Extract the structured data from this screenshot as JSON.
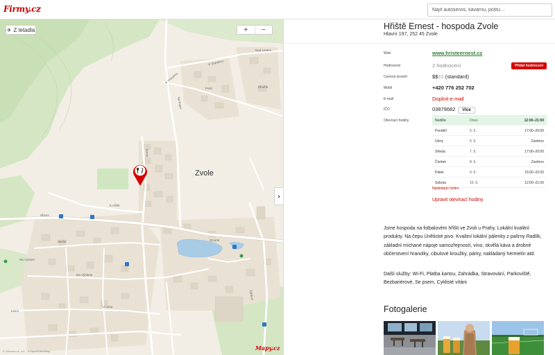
{
  "header": {
    "logo": "Firmy.cz",
    "search_placeholder": "Najít autoservis, kavárnu, poštu…"
  },
  "map": {
    "plane_button": "Z letadla",
    "zoom_in": "+",
    "zoom_out": "−",
    "collapse": "›",
    "labels": {
      "town": "Zvole",
      "nad_lesem": "Nad Lesem",
      "k_vranemu_1": "K Vranému",
      "k_vranemu_2": "K Vranému",
      "strmá": "Strmá",
      "na_kopci": "Na Kopci",
      "polni": "Polní",
      "dlouha": "Dlouhá",
      "k_hristi": "K Hřišti",
      "hlavni": "Hlavní",
      "skolni": "Skolní",
      "na_vyhledu": "Na Výhledu",
      "na_vyslunì": "Na Výsluní",
      "u_lesa": "U Lesa",
      "lesni": "Lesní",
      "dlouha2": "Dlouhá",
      "zabrezi": "Zábřezí"
    },
    "brand": "Mapy.cz",
    "copyright": "© Seznam.cz, a.s. · © OpenStreetMap"
  },
  "business": {
    "name": "Hřiště Ernest - hospoda Zvole",
    "address": "Hlavní 197, 252 45 Zvole",
    "web_label": "Web",
    "web": "www.hristeernest.cz",
    "rating_label": "Hodnocení",
    "rating": "2 hodnocení",
    "add_rating": "Přidat hodnocení",
    "price_label": "Cenová úroveň",
    "price_active": "$$",
    "price_inactive": "$$",
    "price_text": "(standard)",
    "mobile_label": "Mobil",
    "mobile": "+420 776 252 702",
    "email_label": "E-mail",
    "email": "Doplnit e-mail",
    "ico_label": "IČO",
    "ico": "03879682",
    "more": "Více",
    "hours_label": "Otevírací hodiny",
    "hours": [
      {
        "day": "Neděle",
        "date": "Dnes",
        "time": "12:00–21:00"
      },
      {
        "day": "Pondělí",
        "date": "5. 5.",
        "time": "17:00–20:00"
      },
      {
        "day": "Úterý",
        "date": "6. 5.",
        "time": "Zavřeno"
      },
      {
        "day": "Středa",
        "date": "7. 5.",
        "time": "17:00–20:00"
      },
      {
        "day": "Čtvrtek",
        "date": "8. 5.",
        "time": "Zavřeno"
      },
      {
        "day": "Pátek",
        "date": "9. 5.",
        "time": "15:00–22:00"
      },
      {
        "day": "Sobota",
        "date": "10. 5.",
        "time": "12:00–21:00"
      }
    ],
    "next_week": "Následující týden",
    "edit_hours": "Upravit otevírací hodiny",
    "description": "Jsme hospoda na fotbalovém hřišti ve Zvoli u Prahy. Lokální kvalitní produkty. Na čepu Únětické pivo. Kvalitní lokální pálenky z palírny Radlík, základní míchané nápoje samozřejmostí, víno, skvělá káva a drobné občerstvení hranolky, cibulové kroužky, párky, nakládaný hermelín atd.",
    "services": "Další služby:  Wi-Fi, Platba kartou, Zahrádka, Stravování, Parkoviště, Bezbariérové, Se psem, Cyklisté vítáni",
    "gallery_title": "Fotogalerie"
  },
  "colors": {
    "brand_red": "#cc0000",
    "web_green": "#2e7d32",
    "today_bg": "#e3f5e6"
  }
}
